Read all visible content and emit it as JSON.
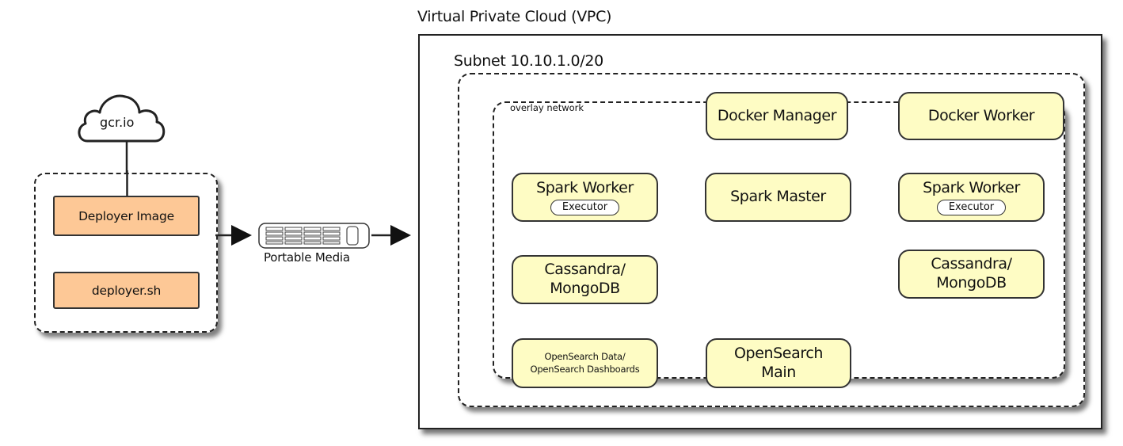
{
  "left_section": {
    "registry": {
      "label": "gcr.io",
      "icon": "cloud-icon"
    },
    "deployer_group": {
      "items": [
        {
          "label": "Deployer Image",
          "color": "#fdc896"
        },
        {
          "label": "deployer.sh",
          "color": "#fdc896"
        }
      ]
    },
    "transfer": {
      "label": "Portable Media",
      "icon": "portable-media-icon"
    }
  },
  "vpc": {
    "title": "Virtual Private Cloud (VPC)",
    "subnet": {
      "title": "Subnet 10.10.1.0/20",
      "overlay": {
        "title": "overlay network",
        "node_color": "#fefcc4",
        "nodes": {
          "docker_manager": {
            "label": "Docker Manager"
          },
          "docker_worker": {
            "label": "Docker Worker"
          },
          "spark_worker_left": {
            "label": "Spark Worker",
            "sub_label": "Executor"
          },
          "spark_master": {
            "label": "Spark Master"
          },
          "spark_worker_right": {
            "label": "Spark Worker",
            "sub_label": "Executor"
          },
          "cassandra_left": {
            "line1": "Cassandra/",
            "line2": "MongoDB"
          },
          "cassandra_right": {
            "line1": "Cassandra/",
            "line2": "MongoDB"
          },
          "opensearch_data": {
            "line1": "OpenSearch Data/",
            "line2": "OpenSearch Dashboards"
          },
          "opensearch_main": {
            "line1": "OpenSearch",
            "line2": "Main"
          }
        }
      }
    }
  }
}
